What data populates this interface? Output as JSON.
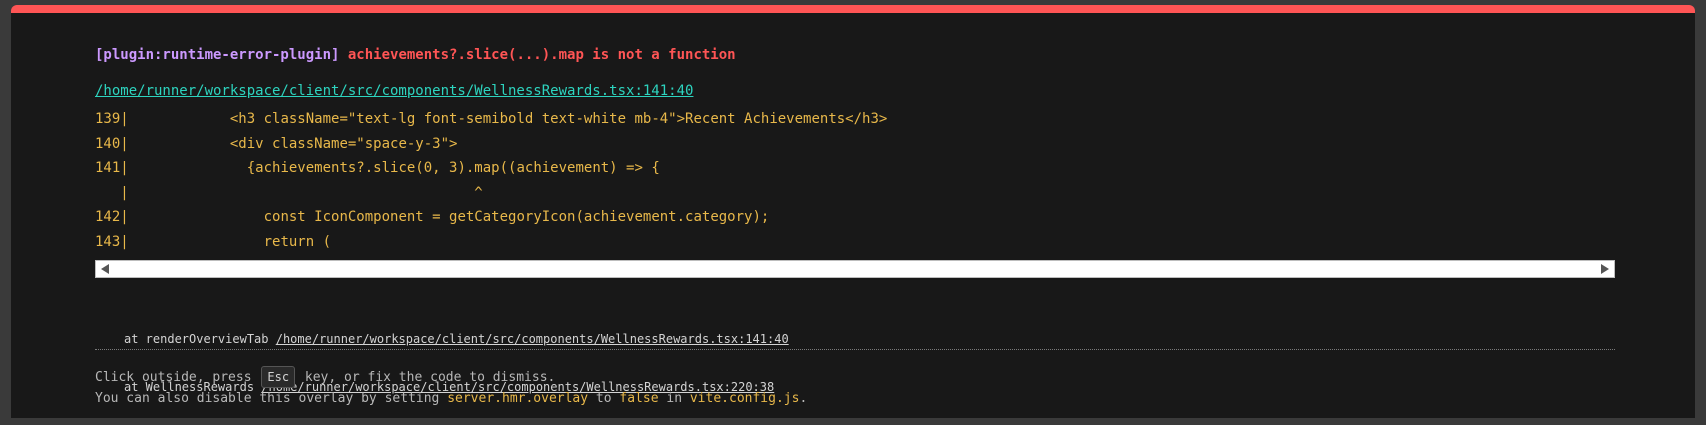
{
  "error": {
    "plugin": "[plugin:runtime-error-plugin]",
    "message": "achievements?.slice(...).map is not a function",
    "file": "/home/runner/workspace/client/src/components/WellnessRewards.tsx:141:40"
  },
  "code_frame": [
    {
      "num": "139",
      "text": "            <h3 className=\"text-lg font-semibold text-white mb-4\">Recent Achievements</h3>"
    },
    {
      "num": "140",
      "text": "            <div className=\"space-y-3\">"
    },
    {
      "num": "141",
      "text": "              {achievements?.slice(0, 3).map((achievement) => {"
    },
    {
      "num": "   ",
      "text": "                                         ^"
    },
    {
      "num": "142",
      "text": "                const IconComponent = getCategoryIcon(achievement.category);"
    },
    {
      "num": "143",
      "text": "                return ("
    }
  ],
  "stack": [
    {
      "prefix": "at renderOverviewTab ",
      "link": "/home/runner/workspace/client/src/components/WellnessRewards.tsx:141:40"
    },
    {
      "prefix": "at WellnessRewards ",
      "link": "/home/runner/workspace/client/src/components/WellnessRewards.tsx:220:38"
    }
  ],
  "tips": {
    "line1_before": "Click outside, press ",
    "key": "Esc",
    "line1_after": " key, or fix the code to dismiss.",
    "line2_a": "You can also disable this overlay by setting ",
    "line2_b": "server.hmr.overlay",
    "line2_c": " to ",
    "line2_d": "false",
    "line2_e": " in ",
    "line2_f": "vite.config.js",
    "line2_g": "."
  },
  "colors": {
    "top_border": "#ff5555",
    "plugin": "#cc99ff",
    "error": "#ff5555",
    "link": "#2dd4bf",
    "code": "#e8b84a"
  }
}
